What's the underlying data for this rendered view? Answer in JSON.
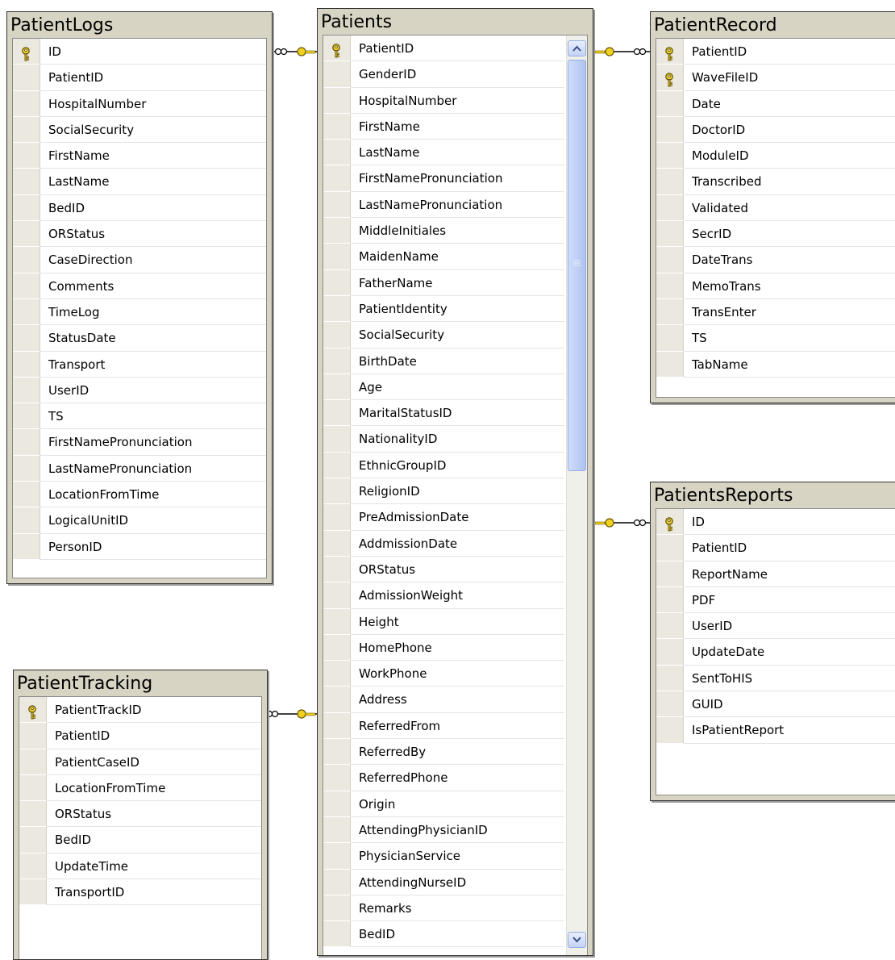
{
  "tables": {
    "patient_logs": {
      "title": "PatientLogs",
      "columns": [
        "ID",
        "PatientID",
        "HospitalNumber",
        "SocialSecurity",
        "FirstName",
        "LastName",
        "BedID",
        "ORStatus",
        "CaseDirection",
        "Comments",
        "TimeLog",
        "StatusDate",
        "Transport",
        "UserID",
        "TS",
        "FirstNamePronunciation",
        "LastNamePronunciation",
        "LocationFromTime",
        "LogicalUnitID",
        "PersonID"
      ],
      "keys": [
        "ID"
      ]
    },
    "patients": {
      "title": "Patients",
      "columns": [
        "PatientID",
        "GenderID",
        "HospitalNumber",
        "FirstName",
        "LastName",
        "FirstNamePronunciation",
        "LastNamePronunciation",
        "MiddleInitiales",
        "MaidenName",
        "FatherName",
        "PatientIdentity",
        "SocialSecurity",
        "BirthDate",
        "Age",
        "MaritalStatusID",
        "NationalityID",
        "EthnicGroupID",
        "ReligionID",
        "PreAdmissionDate",
        "AddmissionDate",
        "ORStatus",
        "AdmissionWeight",
        "Height",
        "HomePhone",
        "WorkPhone",
        "Address",
        "ReferredFrom",
        "ReferredBy",
        "ReferredPhone",
        "Origin",
        "AttendingPhysicianID",
        "PhysicianService",
        "AttendingNurseID",
        "Remarks",
        "BedID"
      ],
      "keys": [
        "PatientID"
      ]
    },
    "patient_record": {
      "title": "PatientRecord",
      "columns": [
        "PatientID",
        "WaveFileID",
        "Date",
        "DoctorID",
        "ModuleID",
        "Transcribed",
        "Validated",
        "SecrID",
        "DateTrans",
        "MemoTrans",
        "TransEnter",
        "TS",
        "TabName"
      ],
      "keys": [
        "PatientID",
        "WaveFileID"
      ]
    },
    "patients_reports": {
      "title": "PatientsReports",
      "columns": [
        "ID",
        "PatientID",
        "ReportName",
        "PDF",
        "UserID",
        "UpdateDate",
        "SentToHIS",
        "GUID",
        "IsPatientReport"
      ],
      "keys": [
        "ID"
      ]
    },
    "patient_tracking": {
      "title": "PatientTracking",
      "columns": [
        "PatientTrackID",
        "PatientID",
        "PatientCaseID",
        "LocationFromTime",
        "ORStatus",
        "BedID",
        "UpdateTime",
        "TransportID"
      ],
      "keys": [
        "PatientTrackID"
      ]
    }
  },
  "colors": {
    "key_gold": "#e8c020",
    "frame": "#d8d4c4",
    "row_selector": "#ebe9df"
  }
}
